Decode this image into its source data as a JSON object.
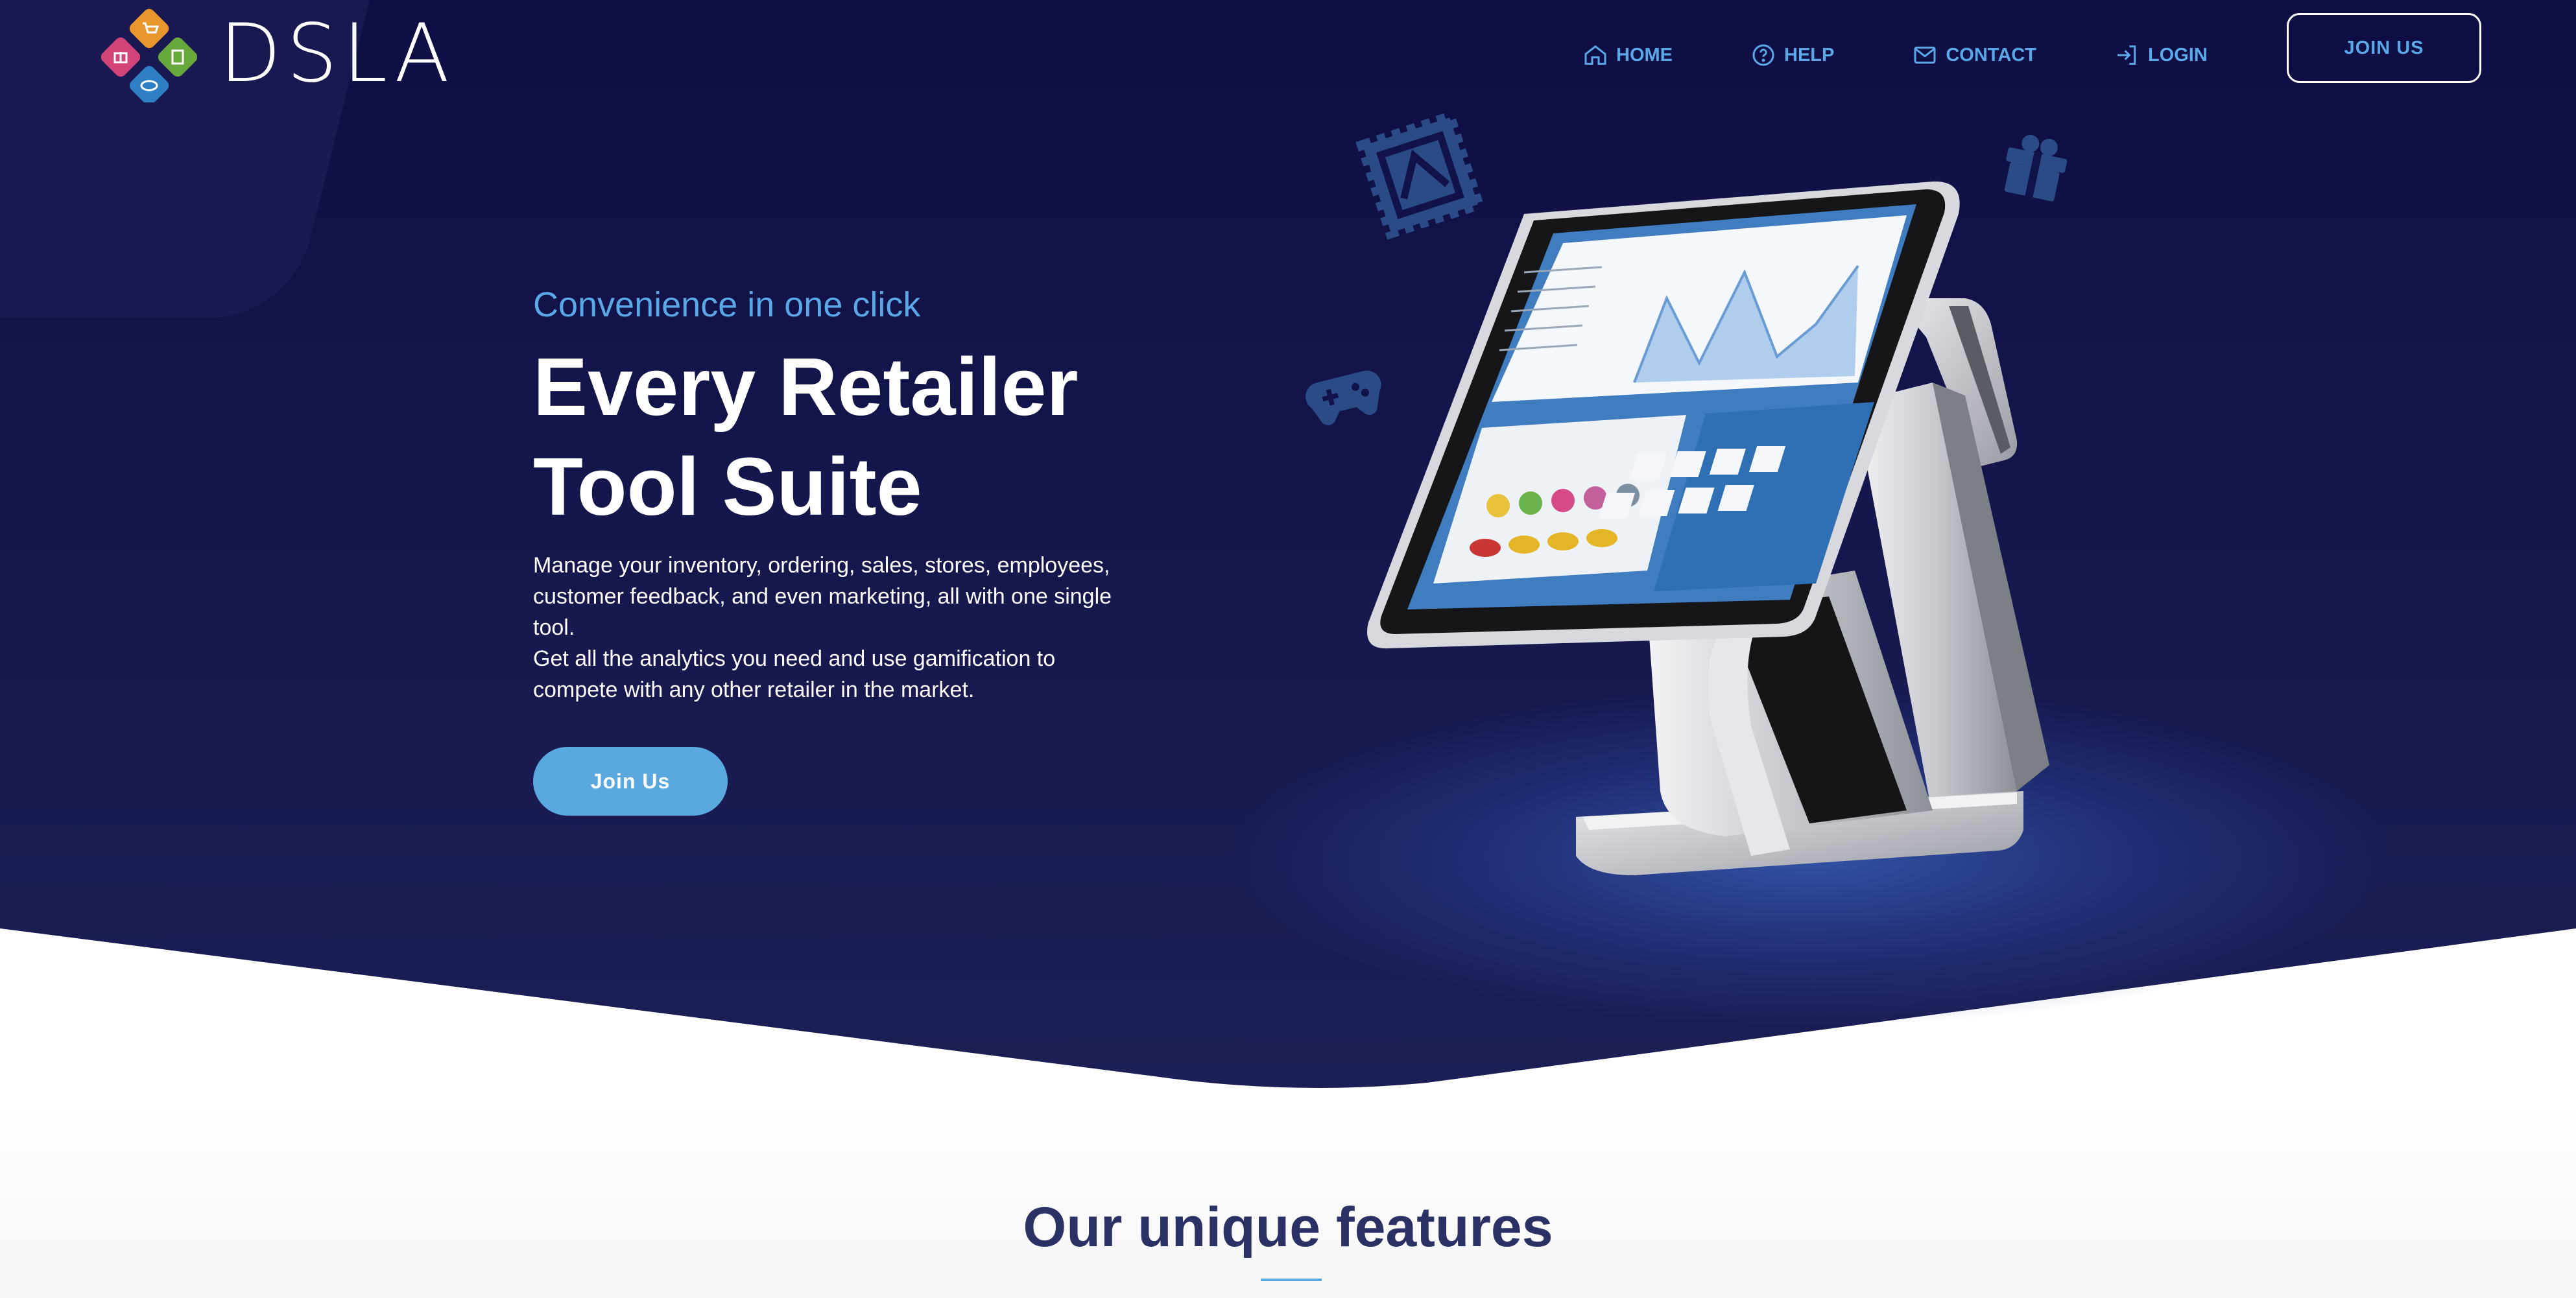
{
  "brand": {
    "name": "DSLA",
    "colors": {
      "hero_bg": "#11114a",
      "accent": "#5aa8e0",
      "heading_dark": "#2a3164"
    }
  },
  "nav": {
    "items": [
      {
        "label": "HOME",
        "icon": "home-icon"
      },
      {
        "label": "HELP",
        "icon": "help-icon"
      },
      {
        "label": "CONTACT",
        "icon": "mail-icon"
      },
      {
        "label": "LOGIN",
        "icon": "login-icon"
      }
    ],
    "join_label": "JOIN US"
  },
  "hero": {
    "eyebrow": "Convenience in one click",
    "title_line1": "Every Retailer",
    "title_line2": "Tool Suite",
    "description_1": "Manage your inventory, ordering, sales, stores, employees, customer feedback, and even marketing, all with one single tool.",
    "description_2": "Get all the analytics you need and use gamification to compete with any other retailer in the market.",
    "cta_label": "Join Us"
  },
  "features": {
    "title": "Our unique features"
  }
}
